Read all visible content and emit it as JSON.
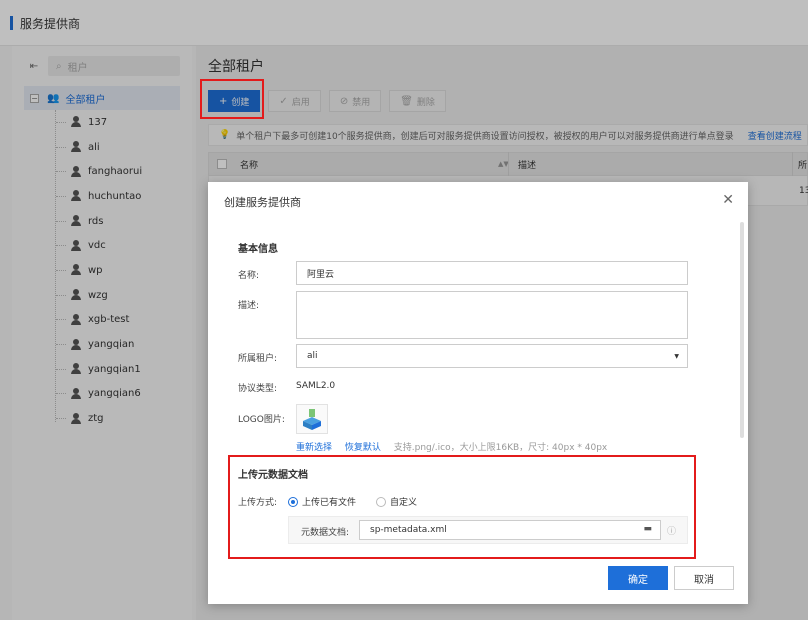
{
  "header": {
    "title": "服务提供商"
  },
  "tree": {
    "search_placeholder": "租户",
    "root_label": "全部租户",
    "items": [
      "137",
      "ali",
      "fanghaorui",
      "huchuntao",
      "rds",
      "vdc",
      "wp",
      "wzg",
      "xgb-test",
      "yangqian",
      "yangqian1",
      "yangqian6",
      "ztg"
    ]
  },
  "main": {
    "title": "全部租户",
    "toolbar": {
      "create": "创建",
      "enable": "启用",
      "disable": "禁用",
      "delete": "删除"
    },
    "notice": "单个租户下最多可创建10个服务提供商，创建后可对服务提供商设置访问授权，被授权的用户可以对服务提供商进行单点登录",
    "notice_link": "查看创建流程",
    "table": {
      "col_name": "名称",
      "col_desc": "描述",
      "col_tenant": "所",
      "row_tenant": "13"
    }
  },
  "dialog": {
    "title": "创建服务提供商",
    "basic_section": "基本信息",
    "name_label": "名称:",
    "name_value": "阿里云",
    "desc_label": "描述:",
    "tenant_label": "所属租户:",
    "tenant_value": "ali",
    "protocol_label": "协议类型:",
    "protocol_value": "SAML2.0",
    "logo_label": "LOGO图片:",
    "logo_reselect": "重新选择",
    "logo_reset": "恢复默认",
    "logo_hint": "支持.png/.ico，大小上限16KB，尺寸: 40px * 40px",
    "upload_section": "上传元数据文档",
    "upload_method_label": "上传方式:",
    "upload_option_file": "上传已有文件",
    "upload_option_custom": "自定义",
    "metadata_label": "元数据文档:",
    "metadata_value": "sp-metadata.xml",
    "ok": "确定",
    "cancel": "取消"
  },
  "colors": {
    "primary": "#1e6fd9",
    "highlight": "#e31b1b"
  }
}
